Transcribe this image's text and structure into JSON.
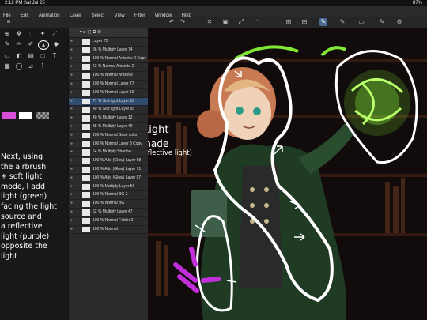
{
  "status": {
    "time": "2:12 PM  Sat Jul 25",
    "battery": "87%"
  },
  "menu": [
    "File",
    "Edit",
    "Animation",
    "Layer",
    "Select",
    "View",
    "Filter",
    "Window",
    "Help"
  ],
  "layers": [
    {
      "name": "Layer 75"
    },
    {
      "name": "36 % Multiply\nLayer 74"
    },
    {
      "name": "100 % Normal\nAnisette 2 Copy"
    },
    {
      "name": "63 % Normal\nAnisette 2"
    },
    {
      "name": "100 % Normal\nAnisette"
    },
    {
      "name": "100 % Normal\nLayer 77"
    },
    {
      "name": "100 % Normal\nLayer 19"
    },
    {
      "name": "71 % Soft light\nLayer 16",
      "selected": true
    },
    {
      "name": "40 % Soft light\nLayer 65"
    },
    {
      "name": "40 % Multiply\nLayer 12"
    },
    {
      "name": "38 % Multiply\nLayer 49"
    },
    {
      "name": "100 % Normal\nBase color"
    },
    {
      "name": "100 % Normal\nLayer 8 Copy"
    },
    {
      "name": "64 % Multiply\nShadow"
    },
    {
      "name": "100 % Add (Glow)\nLayer 68"
    },
    {
      "name": "100 % Add (Glow)\nLayer 71"
    },
    {
      "name": "100 % Add (Glow)\nLayer 57"
    },
    {
      "name": "100 % Multiply\nLayer 56"
    },
    {
      "name": "100 % Normal\nBG 3"
    },
    {
      "name": "100 % Normal\nBG"
    },
    {
      "name": "62 % Multiply\nLayer 47"
    },
    {
      "name": "100 % Normal\nFolder 2"
    },
    {
      "name": "100 % Normal"
    }
  ],
  "notes": "Next, using\nthe airbrush\n+ soft light\nmode, I add\nlight (green)\nfacing the light\nsource and\na reflective\nlight (purple)\nopposite the\nlight",
  "callouts": {
    "light": "Light",
    "shade": "shade",
    "reflective": "(reflective light)"
  },
  "colors": {
    "primary_swatch": "#d64fd6",
    "secondary_swatch": "#ffffff",
    "glow": "#8dff3a",
    "reflect": "#c02fd8"
  }
}
